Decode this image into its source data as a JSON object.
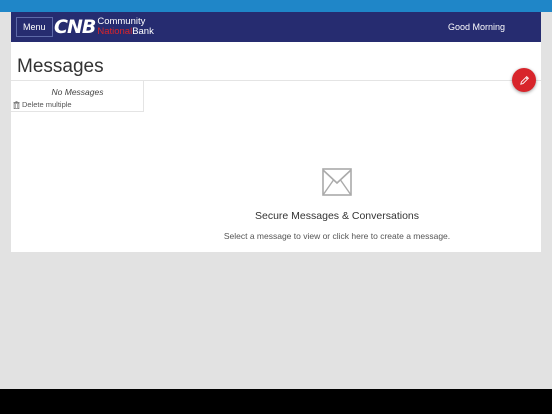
{
  "header": {
    "menu_label": "Menu",
    "logo": {
      "mark": "CNB",
      "line1": "Community",
      "line2_national": "National",
      "line2_bank": "Bank"
    },
    "greeting": "Good Morning"
  },
  "page": {
    "title": "Messages"
  },
  "message_list": {
    "empty_label": "No Messages",
    "delete_multiple_label": "Delete multiple"
  },
  "empty_state": {
    "title": "Secure Messages & Conversations",
    "subtitle_prefix": "Select a message to view or ",
    "subtitle_link": "click here",
    "subtitle_suffix": " to create a message."
  },
  "icons": {
    "trash": "trash-icon",
    "compose": "pencil-icon",
    "envelope": "envelope-icon"
  },
  "colors": {
    "top_strip": "#1f86c8",
    "header_bg": "#262c70",
    "accent_red": "#d8252b",
    "page_bg": "#e2e2e2",
    "bottom_bar": "#000000"
  }
}
